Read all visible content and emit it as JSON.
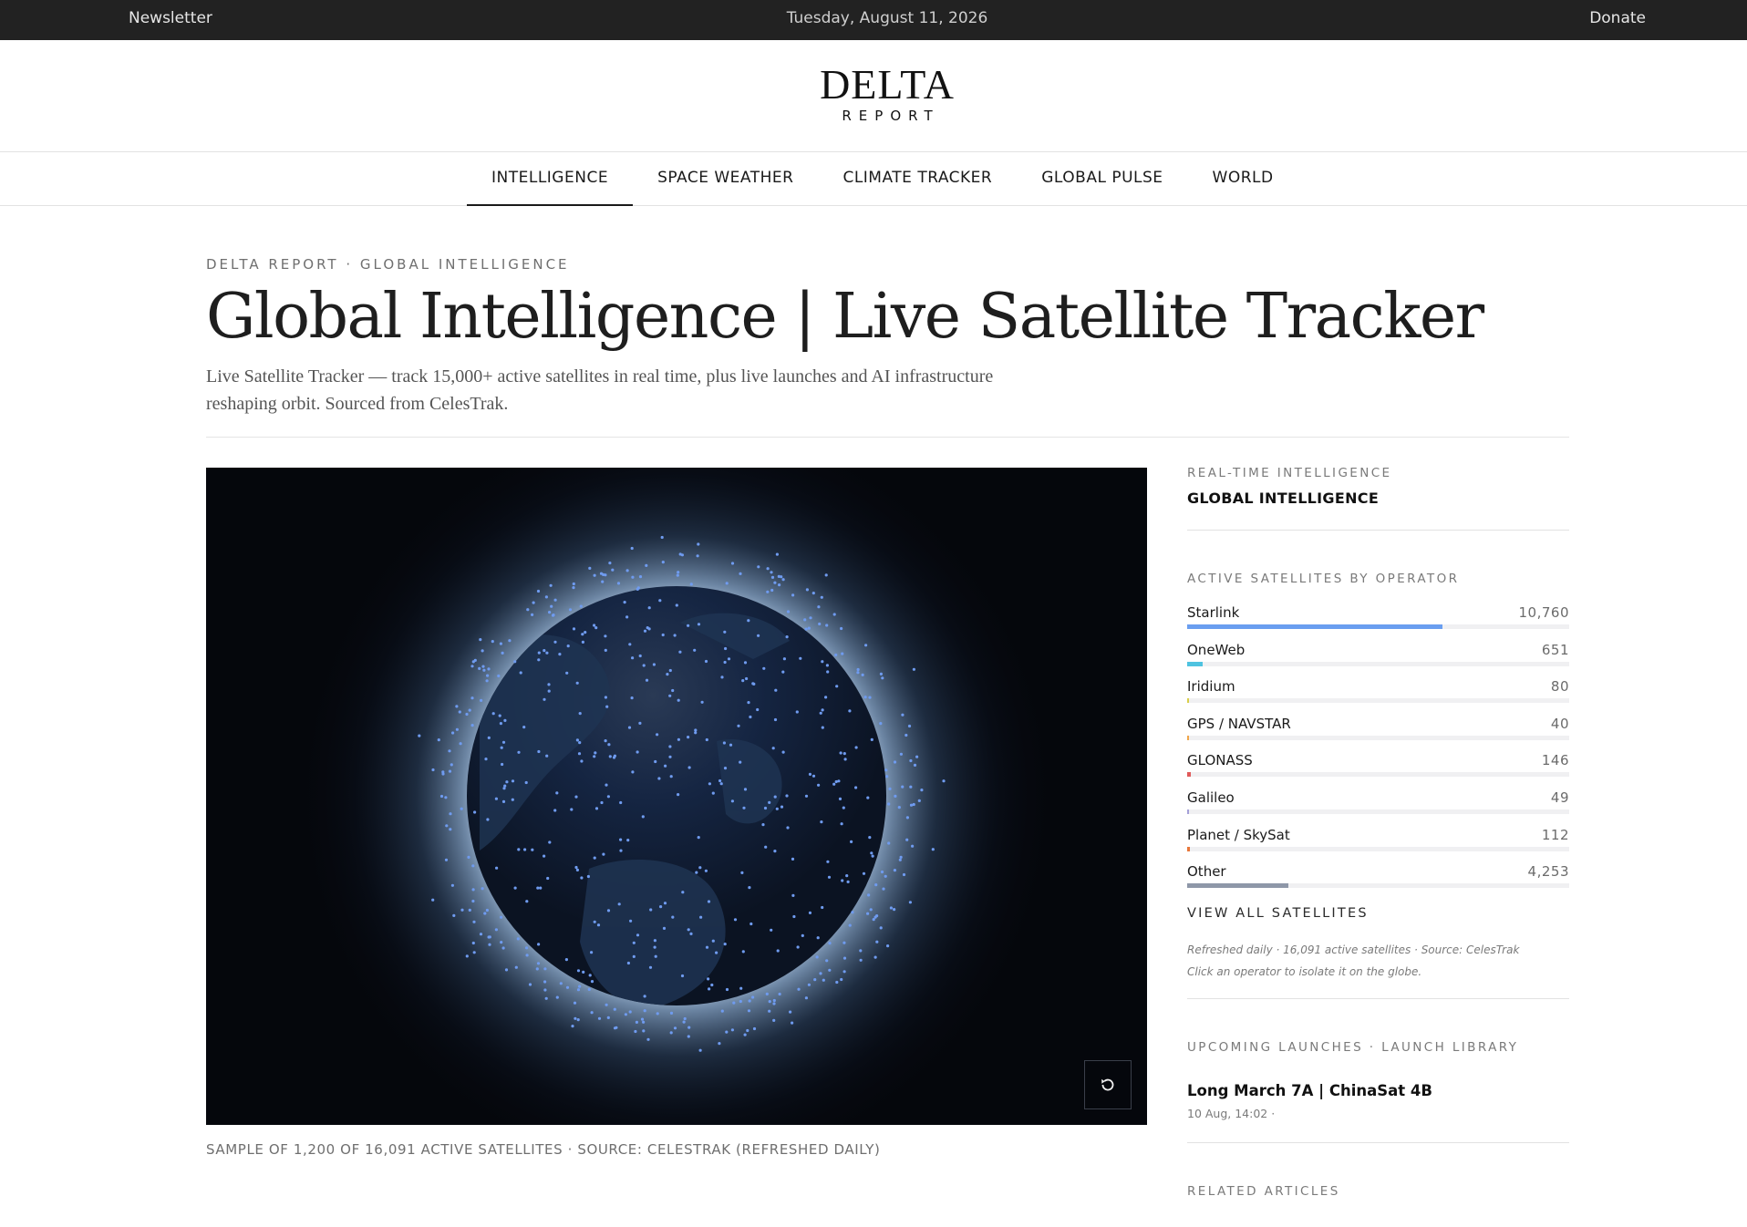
{
  "topbar": {
    "newsletter": "Newsletter",
    "date": "Tuesday, August 11, 2026",
    "donate": "Donate"
  },
  "logo": {
    "line1": "DELTA",
    "line2": "REPORT"
  },
  "nav": [
    "INTELLIGENCE",
    "SPACE WEATHER",
    "CLIMATE TRACKER",
    "GLOBAL PULSE",
    "WORLD"
  ],
  "nav_active": "INTELLIGENCE",
  "header": {
    "eyebrow": "DELTA REPORT · GLOBAL INTELLIGENCE",
    "title": "Global Intelligence | Live Satellite Tracker",
    "lede": "Live Satellite Tracker — track 15,000+ active satellites in real time, plus live launches and AI infrastructure reshaping orbit. Sourced from CelesTrak."
  },
  "globe": {
    "caption": "SAMPLE OF 1,200 OF 16,091 ACTIVE SATELLITES · SOURCE: CELESTRAK (REFRESHED DAILY)",
    "satellite_color": "#6f9bef",
    "reset_icon": "rotate-ccw-icon"
  },
  "sidebar": {
    "kicker": "REAL-TIME INTELLIGENCE",
    "title": "GLOBAL INTELLIGENCE",
    "operators_heading": "ACTIVE SATELLITES BY OPERATOR",
    "operators": [
      {
        "name": "Starlink",
        "count": "10,760",
        "value": 10760,
        "color": "#6a9ef0"
      },
      {
        "name": "OneWeb",
        "count": "651",
        "value": 651,
        "color": "#4fc3e0"
      },
      {
        "name": "Iridium",
        "count": "80",
        "value": 80,
        "color": "#d9cf4a"
      },
      {
        "name": "GPS / NAVSTAR",
        "count": "40",
        "value": 40,
        "color": "#f0a64a"
      },
      {
        "name": "GLONASS",
        "count": "146",
        "value": 146,
        "color": "#e05a5a"
      },
      {
        "name": "Galileo",
        "count": "49",
        "value": 49,
        "color": "#a4a0d8"
      },
      {
        "name": "Planet / SkySat",
        "count": "112",
        "value": 112,
        "color": "#e8773a"
      },
      {
        "name": "Other",
        "count": "4,253",
        "value": 4253,
        "color": "#8e97a8"
      }
    ],
    "view_all": "VIEW ALL SATELLITES",
    "note1": "Refreshed daily · 16,091 active satellites · Source: CelesTrak",
    "note2": "Click an operator to isolate it on the globe.",
    "launches_heading": "UPCOMING LAUNCHES · LAUNCH LIBRARY",
    "launch": {
      "title": "Long March 7A | ChinaSat 4B",
      "meta": "10 Aug, 14:02 ·"
    },
    "related_heading": "RELATED ARTICLES"
  }
}
